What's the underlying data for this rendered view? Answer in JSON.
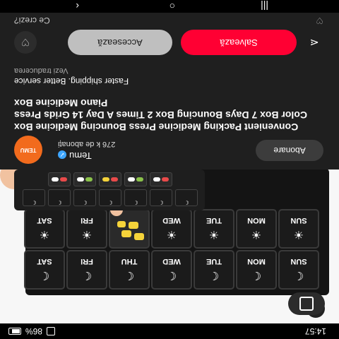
{
  "status_bar": {
    "time": "14:57",
    "battery": "86%"
  },
  "image": {
    "back_icon": "chevron-left-icon",
    "lens_icon": "google-lens-icon",
    "days_top": [
      "SUN",
      "MON",
      "TUE",
      "WED",
      "THU",
      "FRI",
      "SAT"
    ],
    "days_front": [
      "SUN",
      "MON",
      "TUE",
      "WED",
      "THU",
      "FRI",
      "SAT"
    ]
  },
  "channel": {
    "logo_text": "TEMU",
    "name": "Temu",
    "subscribers": "276 k de abonați",
    "follow_label": "Abonare"
  },
  "video": {
    "title": "Convenient Packing Medicine Press Bouncing Medicine Box Color Box 7 Days Bouncing Box 2 Times A Day 14 Grids Press Piano Medicine Box",
    "subtitle": "Faster shipping. Better service",
    "translate_label": "Vezi traducerea"
  },
  "actions": {
    "save_label": "Salvează",
    "access_label": "Accesează"
  },
  "footer": {
    "label": "Ce crezi?"
  },
  "colors": {
    "save": "#ff0033",
    "verified": "#3ea6ff",
    "temu": "#f26b1d"
  }
}
